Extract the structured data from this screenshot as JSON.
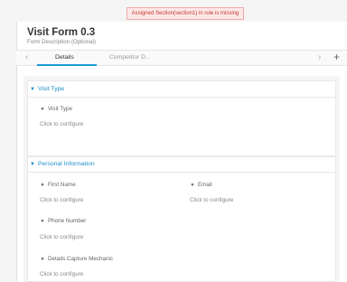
{
  "banner": {
    "error_text": "Assigned Section(section1) in rule is missing"
  },
  "form": {
    "title": "Visit Form 0.3",
    "description": "Form Description (Optional)"
  },
  "tabs": {
    "prev_icon": "‹",
    "next_icon": "›",
    "add_icon": "+",
    "items": [
      {
        "label": "Details",
        "active": true
      },
      {
        "label": "Competitor D...",
        "active": false
      }
    ]
  },
  "sections": [
    {
      "title": "Visit Type",
      "fields": [
        {
          "label": "Visit Type",
          "action": "Click to configure"
        }
      ]
    },
    {
      "title": "Personal Information",
      "fields": [
        {
          "label": "First Name",
          "action": "Click to configure"
        },
        {
          "label": "Email",
          "action": "Click to configure"
        },
        {
          "label": "Phone Number",
          "action": "Click to configure"
        },
        {
          "label": "Details Capture Mechanic",
          "action": "Click to configure"
        }
      ]
    }
  ],
  "colors": {
    "accent": "#1a9bd7",
    "error_bg": "#fde8e8",
    "error_text": "#c0392b"
  },
  "icons": {
    "section_toggle": "chevron-down-icon",
    "field": "person-icon"
  }
}
